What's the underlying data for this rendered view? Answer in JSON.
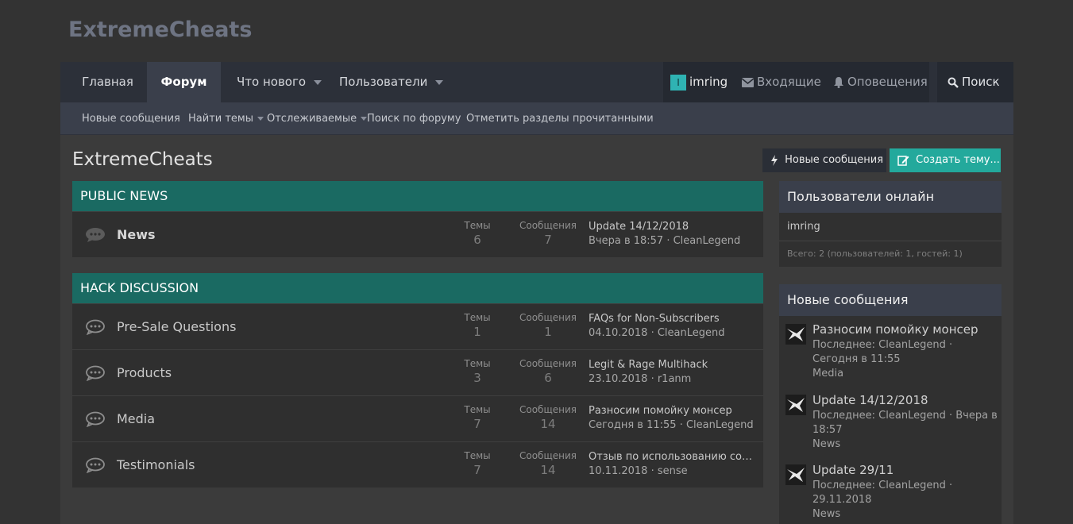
{
  "site": {
    "logo": "ExtremeCheats"
  },
  "nav": {
    "tabs": [
      {
        "label": "Главная"
      },
      {
        "label": "Форум"
      },
      {
        "label": "Что нового"
      },
      {
        "label": "Пользователи"
      }
    ],
    "avatar_letter": "I",
    "username": "imring",
    "inbox": "Входящие",
    "alerts": "Оповещения",
    "search": "Поиск"
  },
  "subnav": {
    "items": [
      {
        "label": "Новые сообщения"
      },
      {
        "label": "Найти темы"
      },
      {
        "label": "Отслеживаемые"
      },
      {
        "label": "Поиск по форуму"
      },
      {
        "label": "Отметить разделы прочитанными"
      }
    ]
  },
  "page": {
    "title": "ExtremeCheats",
    "btn_new_posts": "Новые сообщения",
    "btn_create_thread": "Создать тему..."
  },
  "categories": [
    {
      "title": "PUBLIC NEWS",
      "forums": [
        {
          "title": "News",
          "threads_label": "Темы",
          "threads": "6",
          "posts_label": "Сообщения",
          "posts": "7",
          "last_title": "Update 14/12/2018",
          "last_meta": "Вчера в 18:57 · CleanLegend"
        }
      ]
    },
    {
      "title": "HACK DISCUSSION",
      "forums": [
        {
          "title": "Pre-Sale Questions",
          "threads_label": "Темы",
          "threads": "1",
          "posts_label": "Сообщения",
          "posts": "1",
          "last_title": "FAQs for Non-Subscribers",
          "last_meta": "04.10.2018 · CleanLegend"
        },
        {
          "title": "Products",
          "threads_label": "Темы",
          "threads": "3",
          "posts_label": "Сообщения",
          "posts": "6",
          "last_title": "Legit & Rage Multihack",
          "last_meta": "23.10.2018 · r1anm"
        },
        {
          "title": "Media",
          "threads_label": "Темы",
          "threads": "7",
          "posts_label": "Сообщения",
          "posts": "14",
          "last_title": "Разносим помойку монсер",
          "last_meta": "Сегодня в 11:55 · CleanLegend"
        },
        {
          "title": "Testimonials",
          "threads_label": "Темы",
          "threads": "7",
          "posts_label": "Сообщения",
          "posts": "14",
          "last_title": "Отзыв по использованию софт...",
          "last_meta": "10.11.2018 · sense"
        }
      ]
    }
  ],
  "online": {
    "title": "Пользователи онлайн",
    "user": "imring",
    "total": "Всего: 2 (пользователей: 1, гостей: 1)"
  },
  "new_posts": {
    "title": "Новые сообщения",
    "items": [
      {
        "title": "Разносим помойку монсер",
        "meta": "Последнее: CleanLegend · Сегодня в 11:55",
        "forum": "Media"
      },
      {
        "title": "Update 14/12/2018",
        "meta": "Последнее: CleanLegend · Вчера в 18:57",
        "forum": "News"
      },
      {
        "title": "Update 29/11",
        "meta": "Последнее: CleanLegend · 29.11.2018",
        "forum": "News"
      }
    ]
  }
}
